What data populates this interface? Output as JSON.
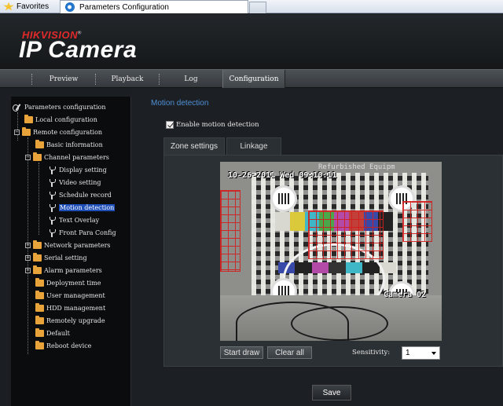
{
  "browser": {
    "favorites_label": "Favorites",
    "tab_title": "Parameters Configuration"
  },
  "header": {
    "brand": "HIKVISION",
    "product": "IP Camera"
  },
  "nav": {
    "items": [
      {
        "label": "Preview"
      },
      {
        "label": "Playback"
      },
      {
        "label": "Log"
      },
      {
        "label": "Configuration",
        "active": true
      }
    ]
  },
  "tree": {
    "root": "Parameters configuration",
    "items": [
      {
        "label": "Local configuration"
      },
      {
        "label": "Remote configuration"
      },
      {
        "label": "Basic information"
      },
      {
        "label": "Channel parameters"
      },
      {
        "label": "Display setting"
      },
      {
        "label": "Video setting"
      },
      {
        "label": "Schedule record"
      },
      {
        "label": "Motion detection",
        "selected": true
      },
      {
        "label": "Text Overlay"
      },
      {
        "label": "Front Para Config"
      },
      {
        "label": "Network parameters"
      },
      {
        "label": "Serial setting"
      },
      {
        "label": "Alarm parameters"
      },
      {
        "label": "Deployment time"
      },
      {
        "label": "User management"
      },
      {
        "label": "HDD management"
      },
      {
        "label": "Remotely upgrade"
      },
      {
        "label": "Default"
      },
      {
        "label": "Reboot device"
      }
    ]
  },
  "main": {
    "section_title": "Motion detection",
    "enable_label": "Enable motion detection",
    "enable_checked": true,
    "tabs": [
      {
        "label": "Zone settings",
        "active": true
      },
      {
        "label": "Linkage"
      }
    ],
    "video": {
      "timestamp": "10-26-2011 Wed 09:10:11",
      "camera_label": "Camera 02",
      "watermark": "Refurbished Equipm"
    },
    "start_draw_label": "Start draw",
    "clear_all_label": "Clear all",
    "sensitivity_label": "Sensitivity:",
    "sensitivity_value": "1",
    "save_label": "Save"
  },
  "colors": {
    "accent_blue": "#4f8fd6",
    "selection": "#1e4fb8",
    "zone_red": "#d21d1d",
    "brand_red": "#e32a2a"
  }
}
